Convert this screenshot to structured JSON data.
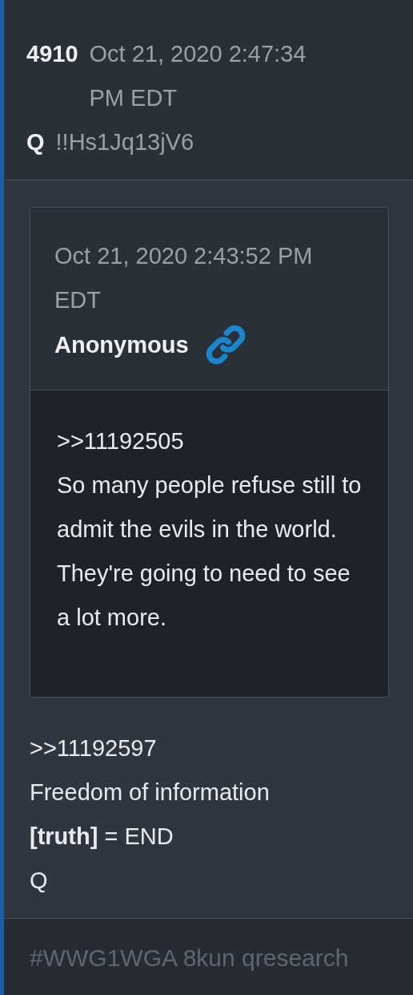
{
  "post": {
    "number": "4910",
    "timestamp": "Oct 21, 2020 2:47:34 PM EDT",
    "author": "Q",
    "tripcode": "!!Hs1Jq13jV6"
  },
  "quote": {
    "timestamp": "Oct 21, 2020 2:43:52 PM EDT",
    "author": "Anonymous",
    "lines": [
      ">>11192505",
      "So many people refuse still to admit the evils in the world. They're going to need to see a lot more."
    ]
  },
  "body": {
    "lines": [
      ">>11192597",
      "Freedom of information",
      "**[truth]** = END",
      "Q"
    ]
  },
  "footer": {
    "tags": "#WWG1WGA 8kun qresearch"
  }
}
